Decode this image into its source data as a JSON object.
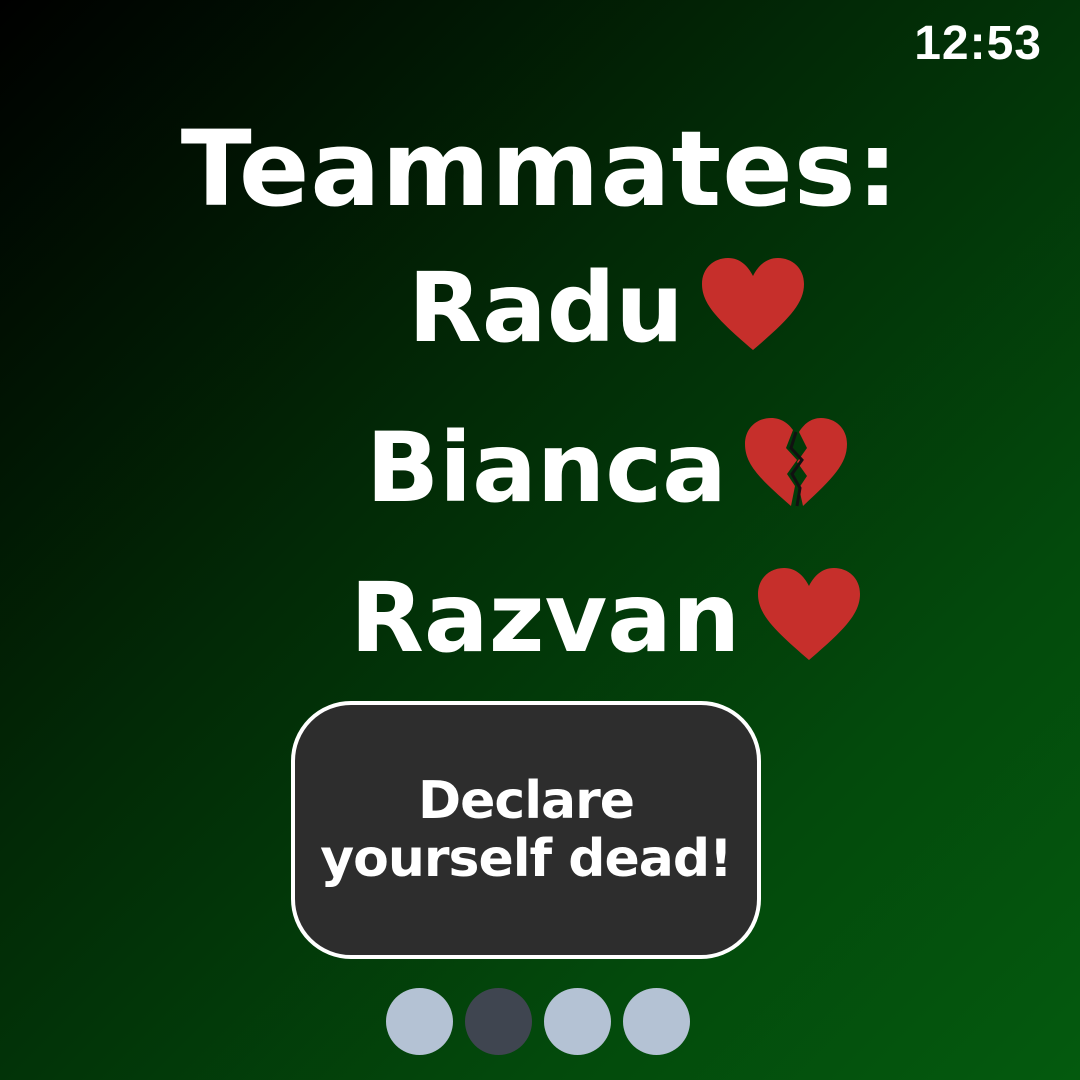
{
  "status": {
    "time": "12:53"
  },
  "title": "Teammates:",
  "teammates": [
    {
      "name": "Radu",
      "status_icon": "heart-icon"
    },
    {
      "name": "Bianca",
      "status_icon": "broken-heart-icon"
    },
    {
      "name": "Razvan",
      "status_icon": "heart-icon"
    }
  ],
  "declare_button": {
    "line1": "Declare",
    "line2": "yourself dead!"
  },
  "pagination": {
    "count": 4,
    "active_index": 1
  },
  "colors": {
    "heart": "#c62f2b",
    "button_bg": "#2d2d2d",
    "dot_inactive": "#b4c2d4",
    "dot_active": "#3f4550"
  }
}
